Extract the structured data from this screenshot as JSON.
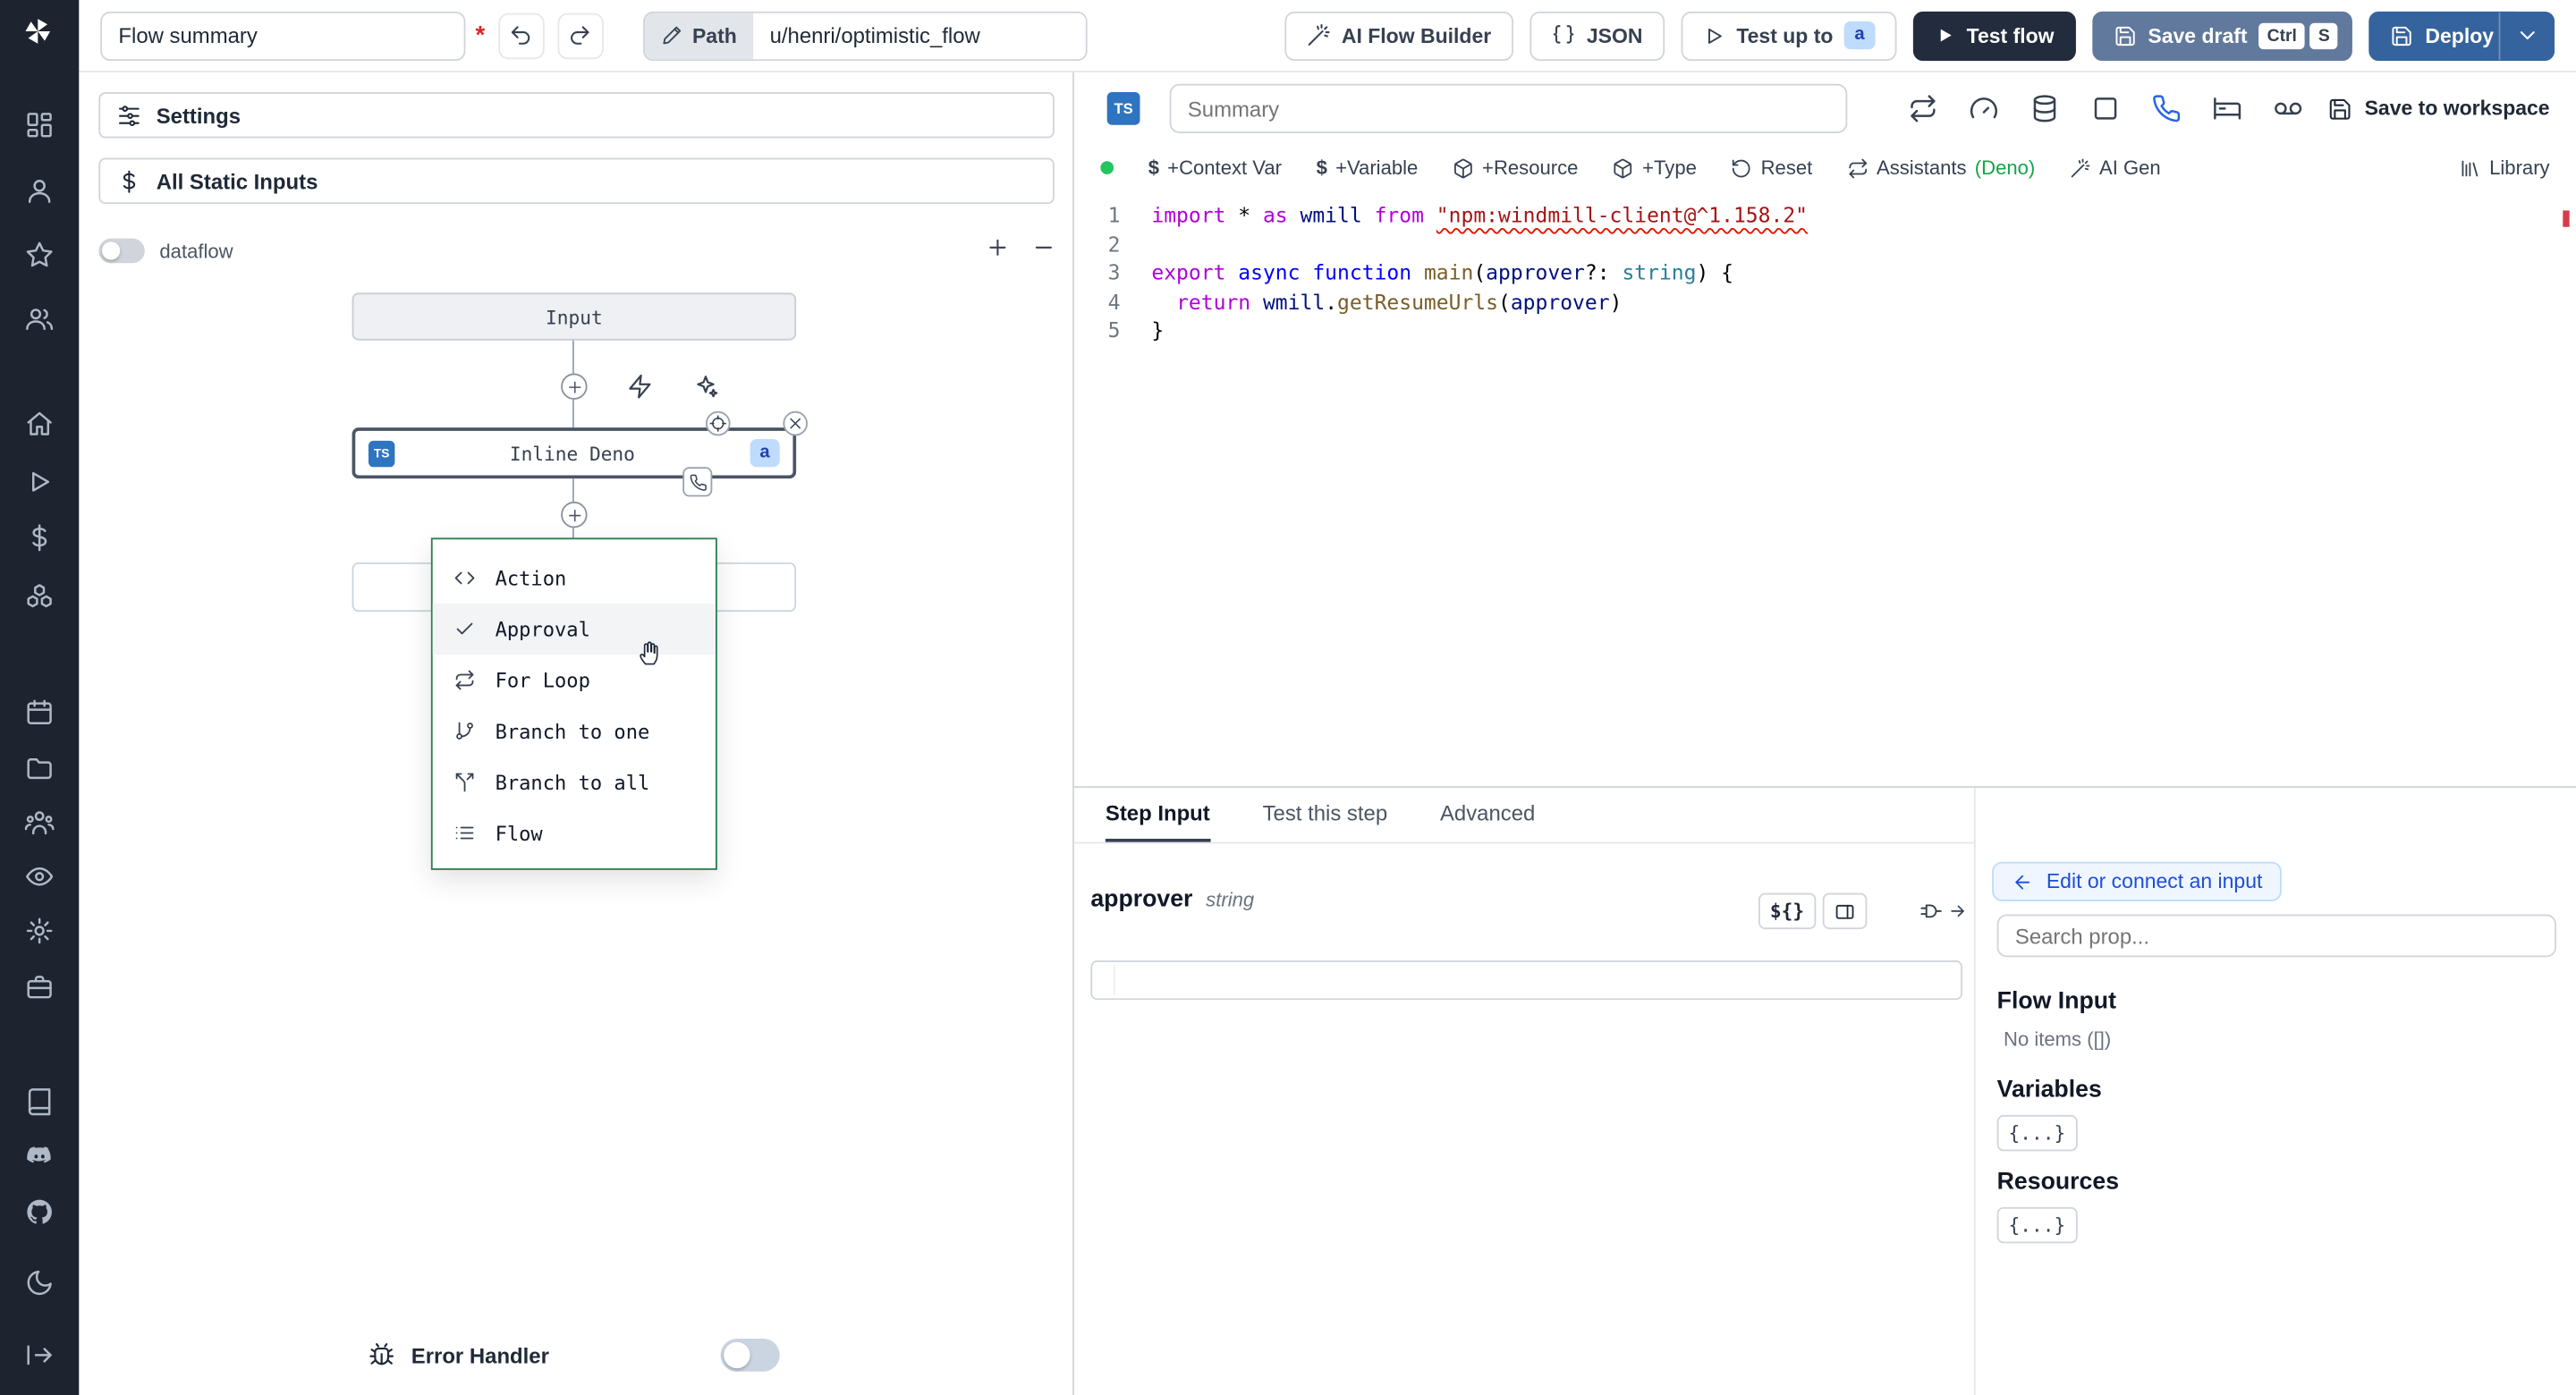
{
  "colors": {
    "rail_bg": "#1d2430",
    "accent_blue": "#2563eb",
    "test_flow_bg": "#222c3d",
    "save_draft_bg": "#60799c",
    "deploy_bg": "#35639e",
    "badge_blue_bg": "#bfdbfe",
    "badge_blue_text": "#1e40af",
    "menu_border_green": "#2e7d51",
    "success_green": "#22c55e",
    "error_red": "#dc2626",
    "ts_badge_blue": "#2f74c0",
    "deno_green": "#16a34a"
  },
  "topbar": {
    "flow_summary_value": "Flow summary",
    "unsaved_indicator": "*",
    "path_label": "Path",
    "path_value": "u/henri/optimistic_flow",
    "ai_flow_builder_label": "AI Flow Builder",
    "json_label": "JSON",
    "test_up_to_label": "Test up to",
    "test_up_to_badge": "a",
    "test_flow_label": "Test flow",
    "save_draft_label": "Save draft",
    "kbd_ctrl": "Ctrl",
    "kbd_s": "S",
    "deploy_label": "Deploy"
  },
  "sidebar": {
    "icons": [
      "windmill-logo",
      "apps",
      "user",
      "star",
      "users",
      "home",
      "runs-play",
      "variables-dollar",
      "resources-boxes",
      "schedules-calendar",
      "folders",
      "groups",
      "audit-eye",
      "settings-gear",
      "workers-briefcase",
      "docs-book",
      "discord",
      "github",
      "dark-mode-moon",
      "expand-arrow"
    ]
  },
  "flow_panel": {
    "settings_label": "Settings",
    "all_static_inputs_label": "All Static Inputs",
    "dataflow_label": "dataflow",
    "input_node_label": "Input",
    "step_node": {
      "lang": "TS",
      "label": "Inline Deno",
      "badge": "a"
    },
    "insert_menu": {
      "items": [
        {
          "label": "Action",
          "icon": "code-icon"
        },
        {
          "label": "Approval",
          "icon": "check-icon",
          "highlighted": true
        },
        {
          "label": "For Loop",
          "icon": "repeat-icon"
        },
        {
          "label": "Branch to one",
          "icon": "branch-icon"
        },
        {
          "label": "Branch to all",
          "icon": "split-icon"
        },
        {
          "label": "Flow",
          "icon": "list-icon"
        }
      ]
    },
    "error_handler_label": "Error Handler"
  },
  "editor": {
    "lang_badge": "TS",
    "summary_placeholder": "Summary",
    "toolbar_icons": [
      "repeat-icon",
      "gauge-icon",
      "database-icon",
      "square-icon",
      "phone-icon",
      "bed-icon",
      "voicemail-icon"
    ],
    "active_toolbar_icon": "phone-icon",
    "save_to_workspace_label": "Save to workspace",
    "add_context_var": "+Context Var",
    "add_variable": "+Variable",
    "add_resource": "+Resource",
    "add_type": "+Type",
    "reset_label": "Reset",
    "assistants_label": "Assistants",
    "assistants_lang": "(Deno)",
    "ai_gen_label": "AI Gen",
    "library_label": "Library",
    "line_numbers": [
      "1",
      "2",
      "3",
      "4",
      "5"
    ],
    "code_lines": [
      [
        [
          "kw",
          "import"
        ],
        [
          "pl",
          " * "
        ],
        [
          "kw",
          "as"
        ],
        [
          "pl",
          " "
        ],
        [
          "vr",
          "wmill"
        ],
        [
          "pl",
          " "
        ],
        [
          "kw",
          "from"
        ],
        [
          "pl",
          " "
        ],
        [
          "st sq",
          "\"npm:windmill-client@^1.158.2\""
        ]
      ],
      [],
      [
        [
          "kw",
          "export"
        ],
        [
          "pl",
          " "
        ],
        [
          "kw2",
          "async"
        ],
        [
          "pl",
          " "
        ],
        [
          "kw2",
          "function"
        ],
        [
          "pl",
          " "
        ],
        [
          "fn",
          "main"
        ],
        [
          "pl",
          "("
        ],
        [
          "vr",
          "approver"
        ],
        [
          "pl",
          "?: "
        ],
        [
          "ty",
          "string"
        ],
        [
          "pl",
          ") {"
        ]
      ],
      [
        [
          "pl",
          "  "
        ],
        [
          "kw",
          "return"
        ],
        [
          "pl",
          " "
        ],
        [
          "vr",
          "wmill"
        ],
        [
          "pl",
          "."
        ],
        [
          "fn",
          "getResumeUrls"
        ],
        [
          "pl",
          "("
        ],
        [
          "vr",
          "approver"
        ],
        [
          "pl",
          ")"
        ]
      ],
      [
        [
          "pl",
          "}"
        ]
      ]
    ]
  },
  "bottom": {
    "tabs": [
      {
        "label": "Step Input",
        "active": true
      },
      {
        "label": "Test this step",
        "active": false
      },
      {
        "label": "Advanced",
        "active": false
      }
    ],
    "field_name": "approver",
    "field_type": "string",
    "field_value": "",
    "expr_button_label": "${}",
    "props": {
      "edit_connect_label": "Edit or connect an input",
      "search_placeholder": "Search prop...",
      "flow_input_heading": "Flow Input",
      "flow_input_empty": "No items ([])",
      "variables_heading": "Variables",
      "variables_badge": "{...}",
      "resources_heading": "Resources",
      "resources_badge": "{...}"
    }
  }
}
